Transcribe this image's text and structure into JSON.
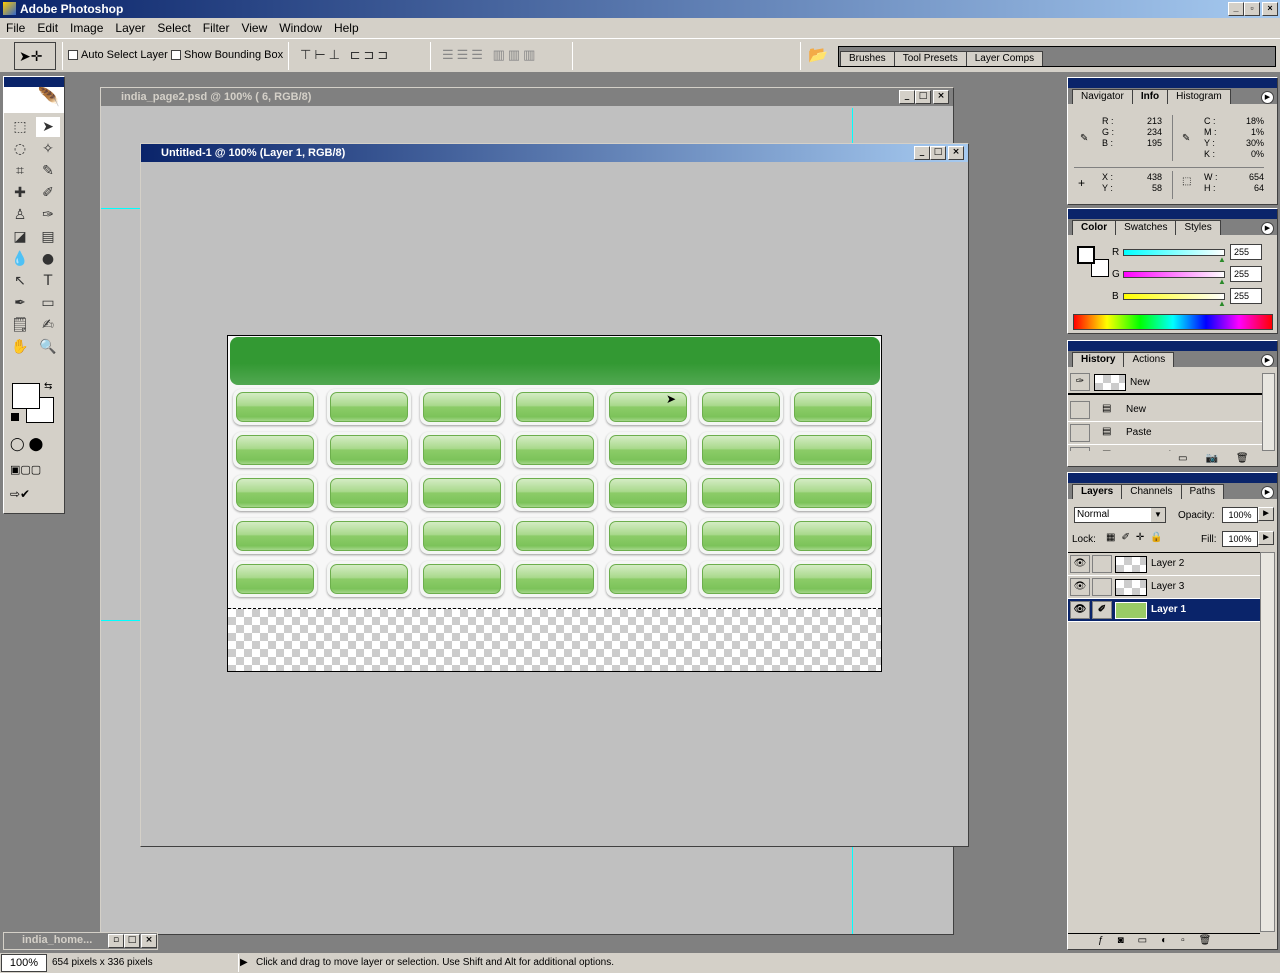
{
  "app": {
    "title": "Adobe Photoshop"
  },
  "menu": [
    "File",
    "Edit",
    "Image",
    "Layer",
    "Select",
    "Filter",
    "View",
    "Window",
    "Help"
  ],
  "options": {
    "auto_select": "Auto Select Layer",
    "bounding_box": "Show Bounding Box",
    "auto_select_checked": false,
    "bounding_box_checked": false
  },
  "palette_well": {
    "tabs": [
      "Brushes",
      "Tool Presets",
      "Layer Comps"
    ]
  },
  "documents": [
    {
      "title": "india_page2.psd @ 100% ( 6, RGB/8)",
      "active": false
    },
    {
      "title": "Untitled-1 @ 100% (Layer 1, RGB/8)",
      "active": true
    }
  ],
  "minimized_doc": {
    "title": "india_home..."
  },
  "canvas": {
    "header_color": "#339933",
    "button_color": "#8cc968",
    "rows": 5,
    "cols": 7
  },
  "info": {
    "tabs": [
      "Navigator",
      "Info",
      "Histogram"
    ],
    "active_tab": "Info",
    "rgb": [
      {
        "k": "R :",
        "v": "213"
      },
      {
        "k": "G :",
        "v": "234"
      },
      {
        "k": "B :",
        "v": "195"
      }
    ],
    "cmyk": [
      {
        "k": "C :",
        "v": "18%"
      },
      {
        "k": "M :",
        "v": "1%"
      },
      {
        "k": "Y :",
        "v": "30%"
      },
      {
        "k": "K :",
        "v": "0%"
      }
    ],
    "xy": [
      {
        "k": "X :",
        "v": "438"
      },
      {
        "k": "Y :",
        "v": "58"
      }
    ],
    "wh": [
      {
        "k": "W :",
        "v": "654"
      },
      {
        "k": "H :",
        "v": "64"
      }
    ]
  },
  "color": {
    "tabs": [
      "Color",
      "Swatches",
      "Styles"
    ],
    "active_tab": "Color",
    "channels": [
      {
        "label": "R",
        "value": "255",
        "grad": "#00ffff"
      },
      {
        "label": "G",
        "value": "255",
        "grad": "#ff00ff"
      },
      {
        "label": "B",
        "value": "255",
        "grad": "#ffff00"
      }
    ]
  },
  "history": {
    "tabs": [
      "History",
      "Actions"
    ],
    "active_tab": "History",
    "snapshot": "New",
    "items": [
      "New",
      "Paste",
      "Rectangular Marquee"
    ]
  },
  "layers": {
    "tabs": [
      "Layers",
      "Channels",
      "Paths"
    ],
    "active_tab": "Layers",
    "blend_mode": "Normal",
    "opacity_label": "Opacity:",
    "opacity": "100%",
    "lock_label": "Lock:",
    "fill_label": "Fill:",
    "fill": "100%",
    "items": [
      {
        "name": "Layer 2",
        "selected": false
      },
      {
        "name": "Layer 3",
        "selected": false
      },
      {
        "name": "Layer 1",
        "selected": true
      }
    ]
  },
  "status": {
    "zoom": "100%",
    "doc_size": "654 pixels x 336 pixels",
    "hint": "Click and drag to move layer or selection.  Use Shift and Alt for additional options."
  },
  "colors": {
    "title_active": "#0a246a",
    "selection": "#0a246a",
    "guide": "#00ffff"
  }
}
